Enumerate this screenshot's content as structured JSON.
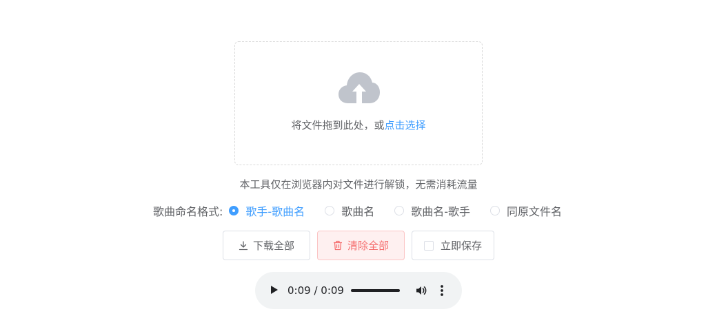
{
  "upload": {
    "icon": "upload-cloud-icon",
    "text_prefix": "将文件拖到此处，或",
    "link_text": "点击选择"
  },
  "tip": "本工具仅在浏览器内对文件进行解锁，无需消耗流量",
  "naming": {
    "label": "歌曲命名格式:",
    "options": [
      {
        "label": "歌手-歌曲名",
        "checked": true
      },
      {
        "label": "歌曲名",
        "checked": false
      },
      {
        "label": "歌曲名-歌手",
        "checked": false
      },
      {
        "label": "同原文件名",
        "checked": false
      }
    ]
  },
  "buttons": {
    "download": "下载全部",
    "clear": "清除全部",
    "save": "立即保存"
  },
  "player": {
    "time": "0:09 / 0:09",
    "progress": 1.0
  },
  "colors": {
    "primary": "#409eff",
    "danger": "#f56c6c",
    "text": "#606266",
    "icon_gray": "#c0c4cc"
  }
}
